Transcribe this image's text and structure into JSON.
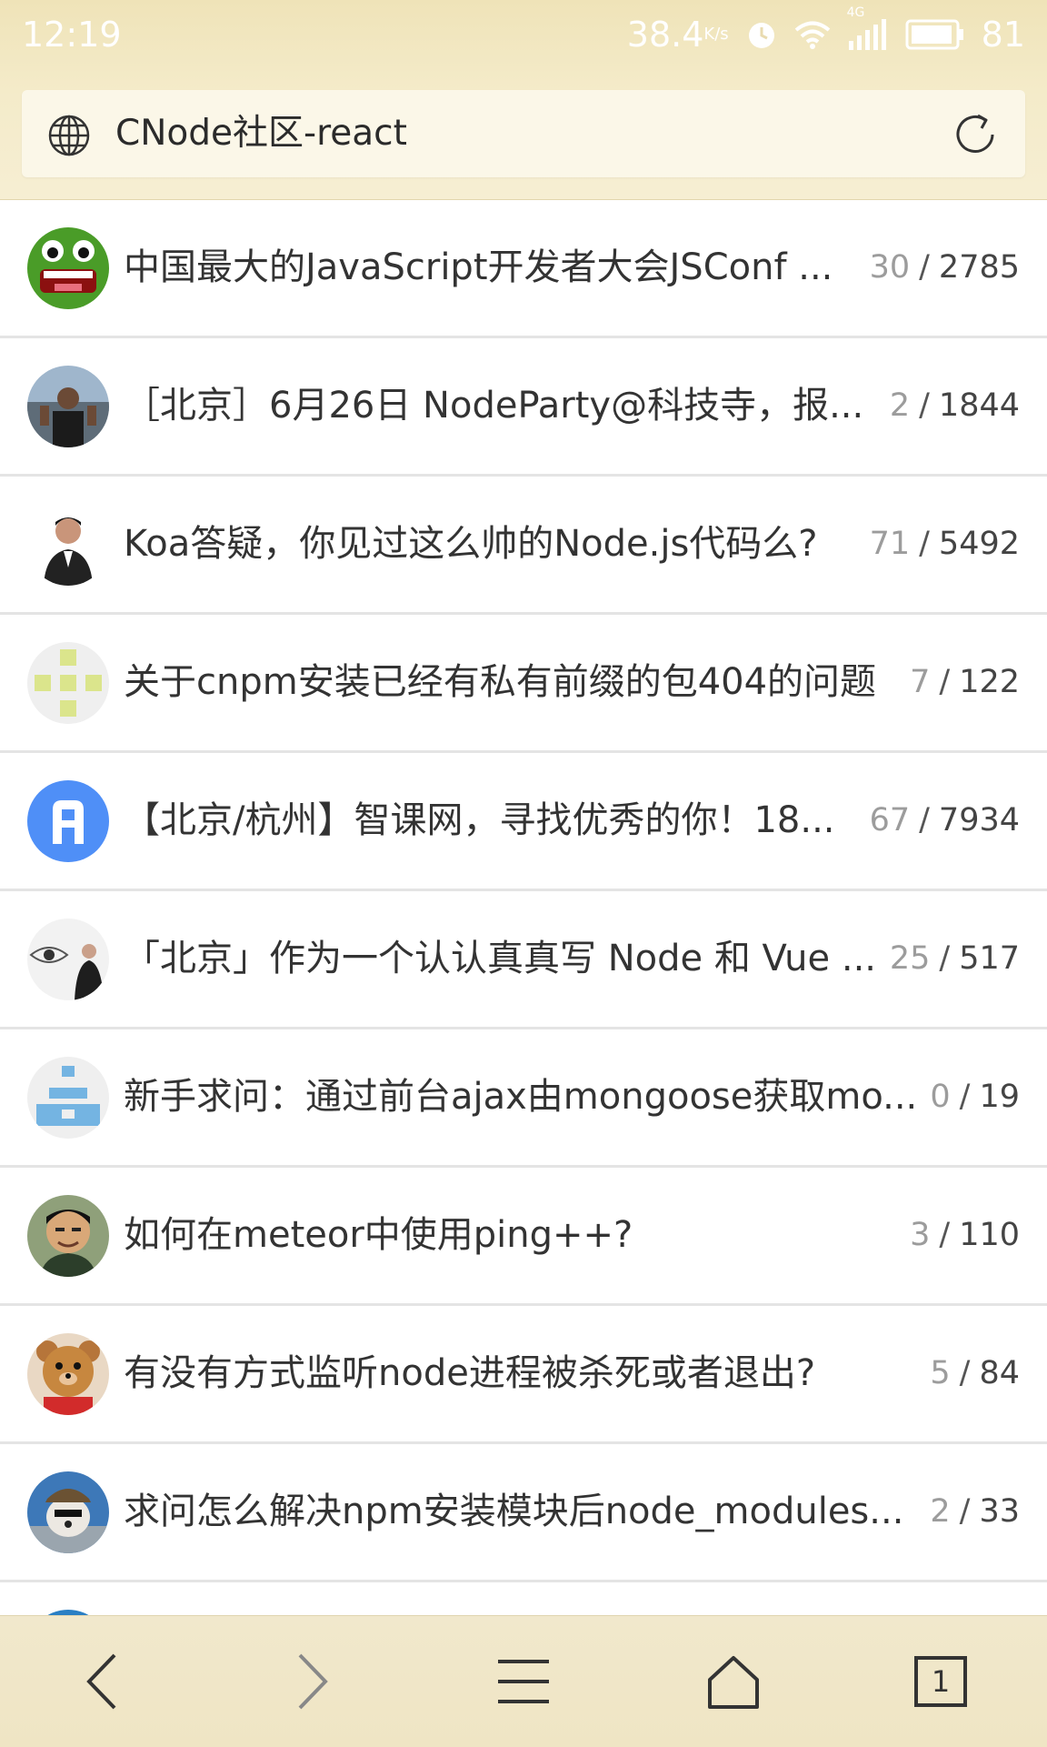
{
  "status_bar": {
    "time": "12:19",
    "speed": "38.4",
    "speed_unit": "K/s",
    "network": "4G",
    "battery": "81"
  },
  "browser": {
    "page_title": "CNode社区-react"
  },
  "topics": [
    {
      "title": "中国最大的JavaScript开发者大会JSConf ...",
      "replies": "30",
      "views": "2785",
      "avatar": "frog-avatar"
    },
    {
      "title": "［北京］6月26日 NodeParty@科技寺，报...",
      "replies": "2",
      "views": "1844",
      "avatar": "beach-person-avatar"
    },
    {
      "title": "Koa答疑，你见过这么帅的Node.js代码么?",
      "replies": "71",
      "views": "5492",
      "avatar": "suit-person-avatar"
    },
    {
      "title": "关于cnpm安装已经有私有前缀的包404的问题",
      "replies": "7",
      "views": "122",
      "avatar": "identicon-avatar"
    },
    {
      "title": "【北京/杭州】智课网，寻找优秀的你！18...",
      "replies": "67",
      "views": "7934",
      "avatar": "blue-logo-avatar"
    },
    {
      "title": "「北京」作为一个认认真真写 Node 和 Vue ...",
      "replies": "25",
      "views": "517",
      "avatar": "eye-sketch-avatar"
    },
    {
      "title": "新手求问：通过前台ajax由mongoose获取mo...",
      "replies": "0",
      "views": "19",
      "avatar": "blue-identicon-avatar"
    },
    {
      "title": "如何在meteor中使用ping++?",
      "replies": "3",
      "views": "110",
      "avatar": "smiling-man-avatar"
    },
    {
      "title": "有没有方式监听node进程被杀死或者退出?",
      "replies": "5",
      "views": "84",
      "avatar": "teddy-bear-avatar"
    },
    {
      "title": "求问怎么解决npm安装模块后node_modules...",
      "replies": "2",
      "views": "33",
      "avatar": "dog-with-hat-avatar"
    }
  ],
  "partial_topic": {
    "avatar": "blue-partial-avatar"
  },
  "bottom_bar": {
    "tab_count": "1"
  },
  "colors": {
    "header_bg": "#f3eacb",
    "title_text": "#333333",
    "reply_count": "#9c9c9c",
    "divider": "#e4e4e4"
  }
}
